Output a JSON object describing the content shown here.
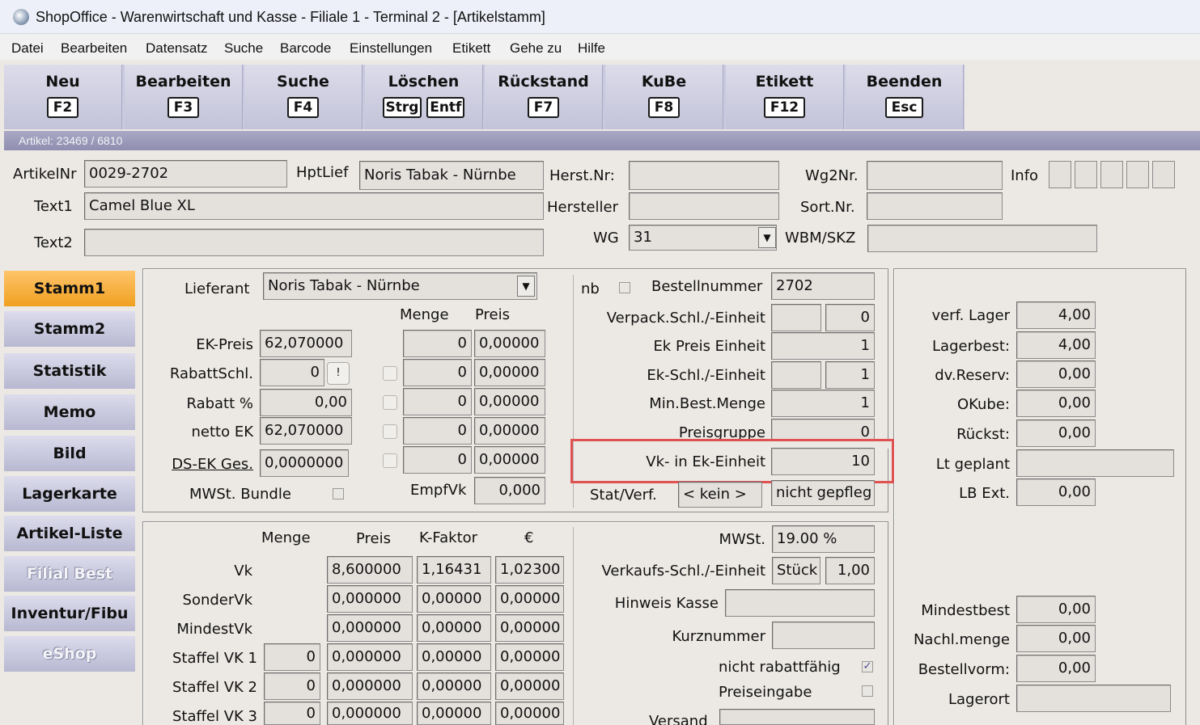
{
  "window": {
    "title": "ShopOffice - Warenwirtschaft und Kasse - Filiale 1 - Terminal 2 - [Artikelstamm]"
  },
  "menu": [
    "Datei",
    "Bearbeiten",
    "Datensatz",
    "Suche",
    "Barcode",
    "Einstellungen",
    "Etikett",
    "Gehe zu",
    "Hilfe"
  ],
  "toolbar": [
    {
      "label": "Neu",
      "keys": [
        "F2"
      ]
    },
    {
      "label": "Bearbeiten",
      "keys": [
        "F3"
      ]
    },
    {
      "label": "Suche",
      "keys": [
        "F4"
      ]
    },
    {
      "label": "Löschen",
      "keys": [
        "Strg",
        "Entf"
      ]
    },
    {
      "label": "Rückstand",
      "keys": [
        "F7"
      ]
    },
    {
      "label": "KuBe",
      "keys": [
        "F8"
      ]
    },
    {
      "label": "Etikett",
      "keys": [
        "F12"
      ]
    },
    {
      "label": "Beenden",
      "keys": [
        "Esc"
      ]
    }
  ],
  "artikel_info": "Artikel: 23469 / 6810",
  "header": {
    "artikelnr_label": "ArtikelNr",
    "artikelnr": "0029-2702",
    "hptlief_label": "HptLief",
    "hptlief": "Noris Tabak - Nürnbe",
    "herstnr_label": "Herst.Nr:",
    "herstnr": "",
    "wg2nr_label": "Wg2Nr.",
    "wg2nr": "",
    "info_label": "Info",
    "text1_label": "Text1",
    "text1": "Camel Blue XL",
    "hersteller_label": "Hersteller",
    "hersteller": "",
    "sortnr_label": "Sort.Nr.",
    "sortnr": "",
    "text2_label": "Text2",
    "text2": "",
    "wg_label": "WG",
    "wg": "31",
    "wbm_label": "WBM/SKZ",
    "wbm": ""
  },
  "sidebar": [
    {
      "label": "Stamm1",
      "state": "active"
    },
    {
      "label": "Stamm2",
      "state": "normal"
    },
    {
      "label": "Statistik",
      "state": "normal"
    },
    {
      "label": "Memo",
      "state": "normal"
    },
    {
      "label": "Bild",
      "state": "normal"
    },
    {
      "label": "Lagerkarte",
      "state": "normal"
    },
    {
      "label": "Artikel-Liste",
      "state": "normal"
    },
    {
      "label": "Filial Best",
      "state": "disabled"
    },
    {
      "label": "Inventur/Fibu",
      "state": "normal"
    },
    {
      "label": "eShop",
      "state": "disabled"
    }
  ],
  "ek": {
    "lieferant_label": "Lieferant",
    "lieferant": "Noris Tabak - Nürnbe",
    "menge_header": "Menge",
    "preis_header": "Preis",
    "ekpreis_label": "EK-Preis",
    "ekpreis": "62,070000",
    "rabattschl_label": "RabattSchl.",
    "rabattschl": "0",
    "rabattschl_btn": "!",
    "rabatt_label": "Rabatt %",
    "rabatt": "0,00",
    "nettoek_label": "netto EK",
    "nettoek": "62,070000",
    "dsek_label": "DS-EK Ges.",
    "dsek": "0,0000000",
    "mwst_bundle_label": "MWSt. Bundle",
    "staffel": [
      {
        "menge": "0",
        "preis": "0,00000"
      },
      {
        "menge": "0",
        "preis": "0,00000"
      },
      {
        "menge": "0",
        "preis": "0,00000"
      },
      {
        "menge": "0",
        "preis": "0,00000"
      },
      {
        "menge": "0",
        "preis": "0,00000"
      }
    ],
    "empfvk_label": "EmpfVk",
    "empfvk": "0,000"
  },
  "best": {
    "nb_label": "nb",
    "bestellnummer_label": "Bestellnummer",
    "bestellnummer": "2702",
    "verpack_label": "Verpack.Schl./-Einheit",
    "verpack_a": "",
    "verpack_b": "0",
    "ekpe_label": "Ek Preis Einheit",
    "ekpe": "1",
    "ekschl_label": "Ek-Schl./-Einheit",
    "ekschl_a": "",
    "ekschl_b": "1",
    "minbest_label": "Min.Best.Menge",
    "minbest": "1",
    "preisgruppe_label": "Preisgruppe",
    "preisgruppe": "0",
    "vkinek_label": "Vk- in Ek-Einheit",
    "vkinek": "10",
    "stat_label": "Stat/Verf.",
    "stat": "< kein >",
    "stat2": "nicht gepfleg"
  },
  "lager": [
    {
      "label": "verf. Lager",
      "value": "4,00"
    },
    {
      "label": "Lagerbest:",
      "value": "4,00"
    },
    {
      "label": "dv.Reserv:",
      "value": "0,00"
    },
    {
      "label": "OKube:",
      "value": "0,00"
    },
    {
      "label": "Rückst:",
      "value": "0,00"
    },
    {
      "label": "Lt geplant",
      "value": ""
    },
    {
      "label": "LB Ext.",
      "value": "0,00"
    }
  ],
  "lager2": [
    {
      "label": "Mindestbest",
      "value": "0,00"
    },
    {
      "label": "Nachl.menge",
      "value": "0,00"
    },
    {
      "label": "Bestellvorm:",
      "value": "0,00"
    }
  ],
  "lagerort_label": "Lagerort",
  "lagerort": "",
  "vk": {
    "menge_header": "Menge",
    "preis_header": "Preis",
    "kfaktor_header": "K-Faktor",
    "euro_header": "€",
    "rows": [
      {
        "label": "Vk",
        "menge": null,
        "preis": "8,600000",
        "kf": "1,16431",
        "eur": "1,02300"
      },
      {
        "label": "SonderVk",
        "menge": null,
        "preis": "0,000000",
        "kf": "0,00000",
        "eur": "0,00000"
      },
      {
        "label": "MindestVk",
        "menge": null,
        "preis": "0,000000",
        "kf": "0,00000",
        "eur": "0,00000"
      },
      {
        "label": "Staffel VK 1",
        "menge": "0",
        "preis": "0,000000",
        "kf": "0,00000",
        "eur": "0,00000"
      },
      {
        "label": "Staffel VK 2",
        "menge": "0",
        "preis": "0,000000",
        "kf": "0,00000",
        "eur": "0,00000"
      },
      {
        "label": "Staffel VK 3",
        "menge": "0",
        "preis": "0,000000",
        "kf": "0,00000",
        "eur": "0,00000"
      }
    ]
  },
  "vk_right": {
    "mwst_label": "MWSt.",
    "mwst": "19.00 %",
    "vkschl_label": "Verkaufs-Schl./-Einheit",
    "vkschl_a": "Stück",
    "vkschl_b": "1,00",
    "hinweis_label": "Hinweis Kasse",
    "hinweis": "",
    "kurz_label": "Kurznummer",
    "kurz": "",
    "nichtrabatt_label": "nicht rabattfähig",
    "preiseingabe_label": "Preiseingabe",
    "versand_label": "Versand"
  }
}
